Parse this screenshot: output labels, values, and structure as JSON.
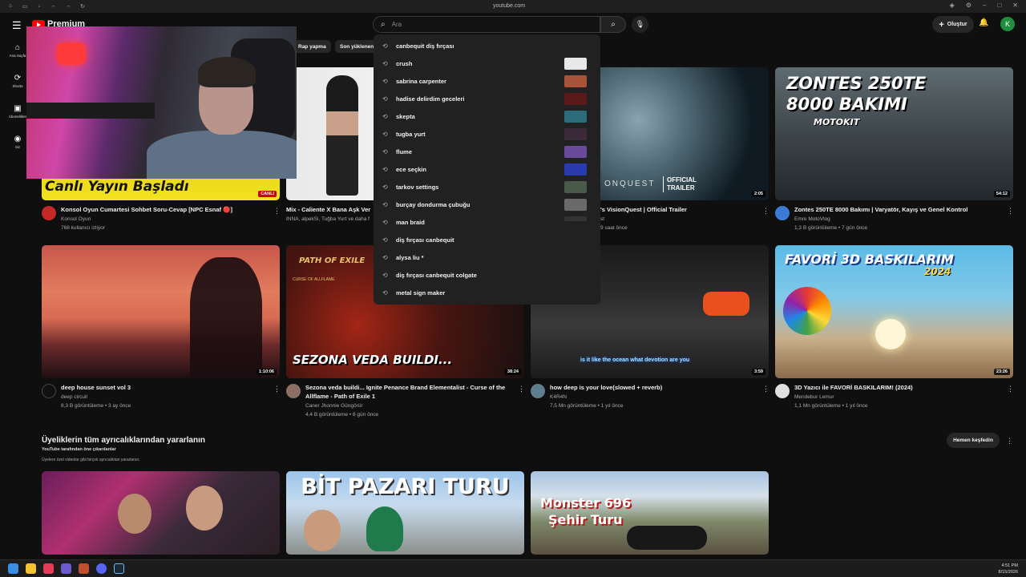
{
  "browser": {
    "url": "youtube.com"
  },
  "header": {
    "logo_text": "Premium",
    "search_placeholder": "Ara",
    "create_label": "Oluştur",
    "avatar_letter": "K"
  },
  "nav": [
    {
      "label": "Ana Sayfa",
      "icon": "home-icon"
    },
    {
      "label": "Shorts",
      "icon": "shorts-icon"
    },
    {
      "label": "Abonelikler",
      "icon": "subscriptions-icon"
    },
    {
      "label": "Siz",
      "icon": "you-icon"
    }
  ],
  "chips": [
    "Rap yapma",
    "Son yüklenen"
  ],
  "suggestions": [
    {
      "text": "canbequit diş fırçası",
      "thumb": false
    },
    {
      "text": "crush",
      "thumb": true
    },
    {
      "text": "sabrina carpenter",
      "thumb": true
    },
    {
      "text": "hadise delirdim geceleri",
      "thumb": true
    },
    {
      "text": "skepta",
      "thumb": true
    },
    {
      "text": "tugba yurt",
      "thumb": true
    },
    {
      "text": "flume",
      "thumb": true
    },
    {
      "text": "ece seçkin",
      "thumb": true
    },
    {
      "text": "tarkov settings",
      "thumb": true
    },
    {
      "text": "burçay dondurma çubuğu",
      "thumb": true
    },
    {
      "text": "man braid",
      "thumb": true
    },
    {
      "text": "diş fırçası canbequit",
      "thumb": false
    },
    {
      "text": "alysa liu *",
      "thumb": false
    },
    {
      "text": "diş fırçası canbequit colgate",
      "thumb": false
    },
    {
      "text": "metal sign maker",
      "thumb": false
    }
  ],
  "row1": [
    {
      "title": "Konsol Oyun Cumartesi Sohbet Soru-Cevap [NPC Esnaf 🔴]",
      "channel": "Konsol Oyun",
      "meta": "768 kullanıcı izliyor",
      "thumb_text": "Canlı Yayın Başladı",
      "badge": "CANLI"
    },
    {
      "title": "Mix - Caliente X Bana Aşk Ver",
      "channel": "INNA, alpekSi, Tuğba Yurt ve daha f",
      "meta": "",
      "thumb_text": ""
    },
    {
      "title": "'s VisionQuest | Official Trailer",
      "channel": "st",
      "meta": "9 saat önce",
      "thumb_text": "OFFICIAL TRAILER",
      "duration": "2:05",
      "thumb_text2": "ONQUEST"
    },
    {
      "title": "Zontes 250TE 8000 Bakımı | Varyatör, Kayış ve Genel Kontrol",
      "channel": "Emre MotoVlog",
      "meta": "1,3 B görüntüleme • 7 gün önce",
      "thumb_text": "ZONTES 250TE",
      "thumb_text2": "8000 BAKIMI",
      "thumb_text3": "MOTOKIT",
      "duration": "54:12"
    }
  ],
  "row2": [
    {
      "title": "deep house sunset vol 3",
      "channel": "deep circuit",
      "meta": "8,3 B görüntüleme • 3 ay önce",
      "duration": "1:10:06"
    },
    {
      "title": "Sezona veda buildi... Ignite Penance Brand Elementalist - Curse of the",
      "title2": "Allflame - Path of Exile 1",
      "channel": "Caner Jhonnie Güngörür",
      "meta": "4,4 B görüntüleme • 8 gün önce",
      "thumb_text": "SEZONA VEDA BUILDI...",
      "thumb_text2": "PATH OF EXILE",
      "thumb_text3": "CURSE OF ALLFLAME",
      "duration": "38:24"
    },
    {
      "title": "how deep is your love(slowed + reverb)",
      "channel": "K4R4N",
      "meta": "7,5 Mn görüntüleme • 1 yıl önce",
      "thumb_text": "is it like the ocean what devotion are you",
      "duration": "3:59"
    },
    {
      "title": "3D Yazıcı ile FAVORİ BASKILARIM! (2024)",
      "channel": "Mendebur Lemur",
      "meta": "1,1 Mn görüntüleme • 1 yıl önce",
      "thumb_text": "FAVORİ 3D BASKILARIM",
      "thumb_text2": "2024",
      "duration": "23:26"
    }
  ],
  "section": {
    "title": "Üyeliklerin tüm ayrıcalıklarından yararlanın",
    "sub1": "YouTube tarafından öne çıkarılanlar",
    "sub2": "Üyelere özel videolar gibi birçok ayrıcalıktan yararlanın.",
    "button": "Hemen keşfedin"
  },
  "row3": [
    {
      "thumb_text": ""
    },
    {
      "thumb_text": "BİT PAZARI TURU"
    },
    {
      "thumb_text": "Monster 696",
      "thumb_text2": "Şehir Turu"
    }
  ],
  "taskbar": {
    "time": "4:51 PM",
    "date": "8/15/2026"
  }
}
